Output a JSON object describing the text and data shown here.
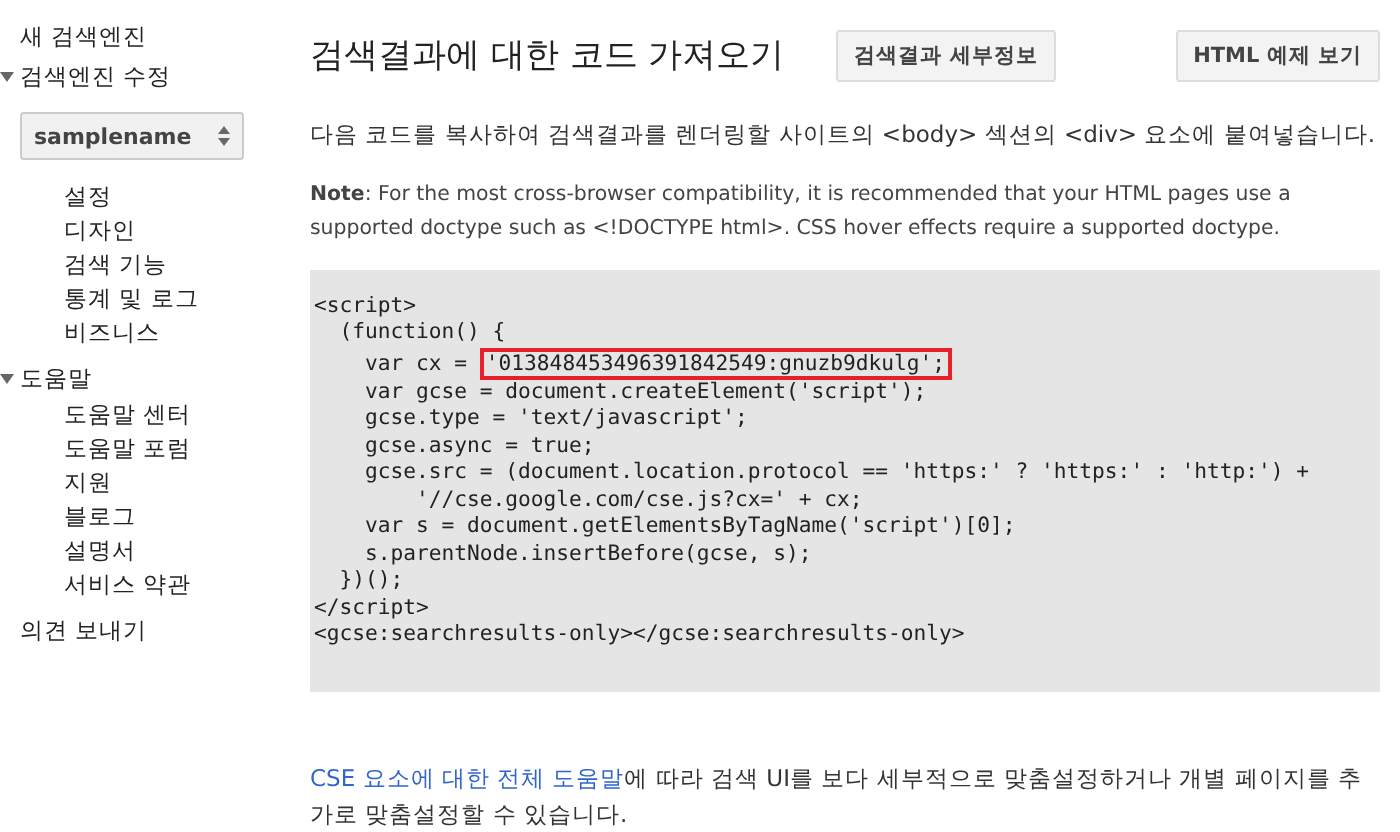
{
  "sidebar": {
    "items": [
      {
        "label": "새 검색엔진",
        "expanded": false
      },
      {
        "label": "검색엔진 수정",
        "expanded": true,
        "select": {
          "value": "samplename"
        },
        "children": [
          {
            "label": "설정"
          },
          {
            "label": "디자인"
          },
          {
            "label": "검색 기능"
          },
          {
            "label": "통계 및 로그"
          },
          {
            "label": "비즈니스"
          }
        ]
      },
      {
        "label": "도움말",
        "expanded": true,
        "children": [
          {
            "label": "도움말 센터"
          },
          {
            "label": "도움말 포럼"
          },
          {
            "label": "지원"
          },
          {
            "label": "블로그"
          },
          {
            "label": "설명서"
          },
          {
            "label": "서비스 약관"
          }
        ]
      },
      {
        "label": "의견 보내기",
        "expanded": false
      }
    ]
  },
  "header": {
    "title": "검색결과에 대한 코드 가져오기",
    "buttons": [
      "검색결과 세부정보",
      "HTML 예제 보기"
    ]
  },
  "intro": "다음 코드를 복사하여 검색결과를 렌더링할 사이트의 <body> 섹션의 <div> 요소에 붙여넣습니다.",
  "note": "**Note**: For the most cross-browser compatibility, it is recommended that your HTML pages use a supported doctype such as <!DOCTYPE html>. CSS hover effects require a supported doctype.",
  "code": [
    {
      "text": "<script>"
    },
    {
      "text": "  (function() {"
    },
    {
      "text": "    var cx = ",
      "highlight": "'013848453496391842549:gnuzb9dkulg';"
    },
    {
      "text": "    var gcse = document.createElement('script');"
    },
    {
      "text": "    gcse.type = 'text/javascript';"
    },
    {
      "text": "    gcse.async = true;"
    },
    {
      "text": "    gcse.src = (document.location.protocol == 'https:' ? 'https:' : 'http:') +"
    },
    {
      "text": "        '//cse.google.com/cse.js?cx=' + cx;"
    },
    {
      "text": "    var s = document.getElementsByTagName('script')[0];"
    },
    {
      "text": "    s.parentNode.insertBefore(gcse, s);"
    },
    {
      "text": "  })();"
    },
    {
      "text": "</script>"
    },
    {
      "text": "<gcse:searchresults-only></gcse:searchresults-only>"
    }
  ],
  "footer": {
    "link": "CSE 요소에 대한 전체 도움말",
    "text": "에 따라 검색 UI를 보다 세부적으로 맞춤설정하거나 개별 페이지를 추가로 맞춤설정할 수 있습니다."
  }
}
